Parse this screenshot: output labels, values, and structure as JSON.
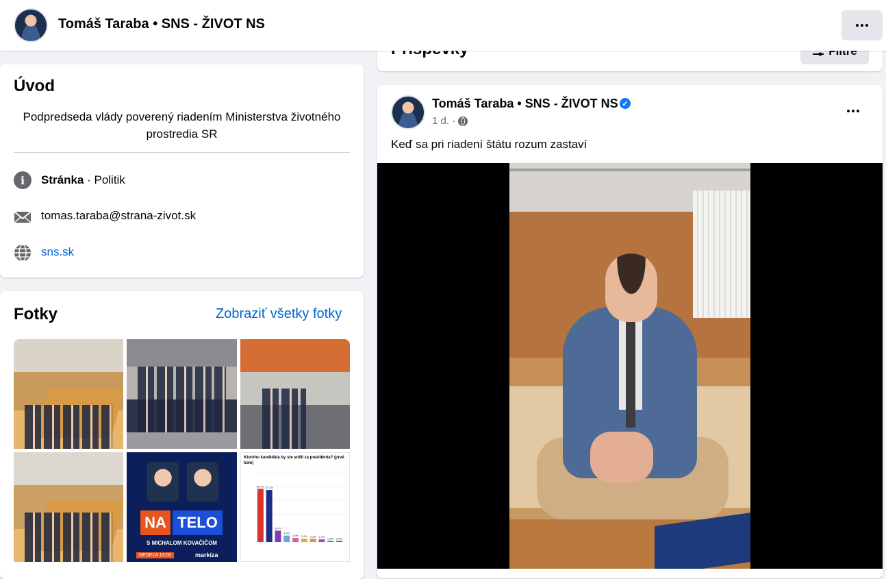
{
  "header": {
    "page_name": "Tomáš Taraba • SNS - ŽIVOT NS"
  },
  "intro": {
    "title": "Úvod",
    "bio": "Podpredseda vlády poverený riadením Ministerstva životného prostredia SR",
    "category_bold": "Stránka",
    "category_rest": " · Politik",
    "email": "tomas.taraba@strana-zivot.sk",
    "website": "sns.sk",
    "info_glyph": "i"
  },
  "photos": {
    "title": "Fotky",
    "see_all": "Zobraziť všetky fotky",
    "natelo": {
      "na": "NA",
      "telo": "TELO",
      "subtitle": "S MICHALOM KOVAČIČOM",
      "airtime": "NEDEĽA 13:00",
      "brand": "markíza"
    },
    "poll": {
      "title": "Ktorého kandidáta by ste volili za prezidenta? (prvé kolo)"
    }
  },
  "posts": {
    "title": "Príspevky",
    "filter_label": "Filtre"
  },
  "post": {
    "author": "Tomáš Taraba • SNS - ŽIVOT NS",
    "verified_glyph": "✓",
    "time": "1 d. ·",
    "text": "Keď sa pri riadení štátu rozum zastaví"
  },
  "chart_data": {
    "type": "bar",
    "title": "Ktorého kandidáta by ste volili za prezidenta? (prvé kolo)",
    "values": [
      38.1,
      37.2,
      8.1,
      4.6,
      2.9,
      2.4,
      2.3,
      1.9,
      0.8,
      0.8
    ],
    "value_labels": [
      "38.1%",
      "37.2%",
      "8.1%",
      "4.6%",
      "2.9%",
      "2.4%",
      "2.3%",
      "1.9%",
      "0.8%",
      "0.8%"
    ],
    "colors": [
      "#d8342b",
      "#1b2f8a",
      "#7b3fb0",
      "#69a7e0",
      "#e25b9a",
      "#f0a63a",
      "#f08b3a",
      "#9e4fbf",
      "#2d9a3f",
      "#c0392b"
    ],
    "ylim": [
      0,
      50
    ]
  }
}
